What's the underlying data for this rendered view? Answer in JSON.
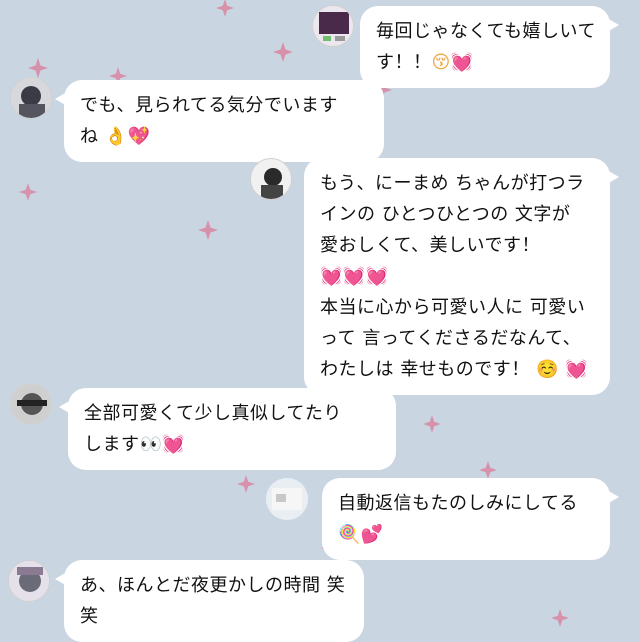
{
  "colors": {
    "background": "#c9d6e2",
    "bubble": "#ffffff",
    "heart": "#ff4fa3",
    "star": "#d98aa6"
  },
  "messages": [
    {
      "side": "right",
      "avatar": "avatar-photo",
      "lines": [
        "毎回じゃなくても嬉しいて",
        "す！！"
      ],
      "emoji": [
        "kissing-face-emoji",
        "heart-emoji"
      ]
    },
    {
      "side": "left",
      "avatar": "avatar-photo",
      "lines": [
        "でも、見られてる気分でいます",
        "ね"
      ],
      "emoji": [
        "ok-hand-emoji",
        "sparkling-heart-emoji"
      ]
    },
    {
      "side": "right",
      "avatar": "avatar-photo",
      "lines": [
        "もう、にーまめ ちゃんが打つラ",
        "インの ひとつひとつの 文字が",
        "愛おしくて、美しいです！",
        "本当に心から可愛い人に 可愛い",
        "って 言ってくださるだなんて、",
        "わたしは 幸せものです！"
      ],
      "emoji": [
        "heart-emoji",
        "heart-emoji",
        "heart-emoji",
        "smiling-face-emoji",
        "heart-emoji"
      ]
    },
    {
      "side": "left",
      "avatar": "avatar-photo",
      "lines": [
        "全部可愛くて少し真似してたり",
        "します"
      ],
      "emoji": [
        "eyes-emoji",
        "heart-emoji"
      ]
    },
    {
      "side": "right",
      "avatar": "avatar-photo",
      "lines": [
        "自動返信もたのしみにしてる"
      ],
      "emoji": [
        "lollipop-emoji",
        "two-hearts-emoji"
      ]
    },
    {
      "side": "left",
      "avatar": "avatar-photo",
      "lines": [
        "あ、ほんとだ夜更かしの時間 笑",
        "笑"
      ],
      "emoji": []
    }
  ]
}
